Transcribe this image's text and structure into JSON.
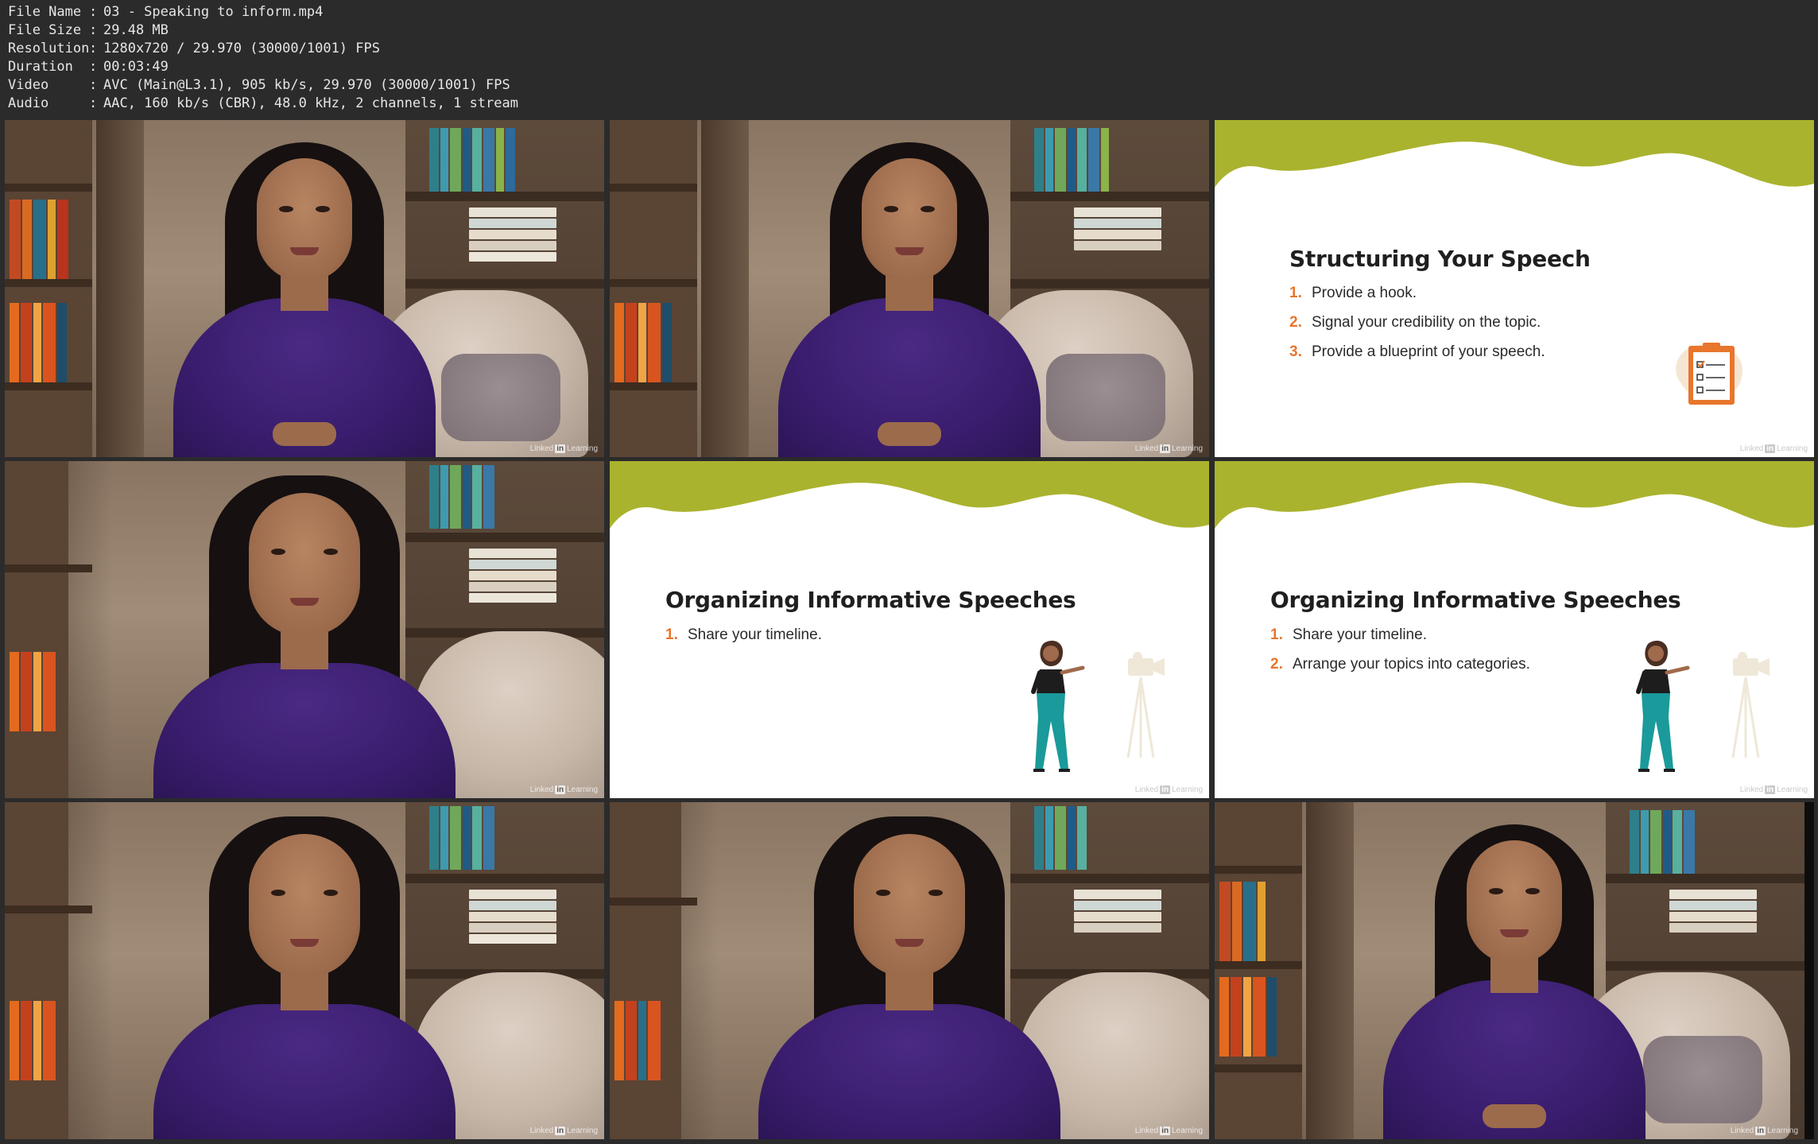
{
  "metadata": [
    {
      "key": "File Name",
      "sep": ":",
      "value": "03 - Speaking to inform.mp4"
    },
    {
      "key": "File Size",
      "sep": ":",
      "value": "29.48 MB"
    },
    {
      "key": "Resolution",
      "sep": ":",
      "value": "1280x720 / 29.970 (30000/1001) FPS"
    },
    {
      "key": "Duration",
      "sep": ":",
      "value": "00:03:49"
    },
    {
      "key": "Video",
      "sep": ":",
      "value": "AVC (Main@L3.1), 905 kb/s, 29.970 (30000/1001) FPS"
    },
    {
      "key": "Audio",
      "sep": ":",
      "value": "AAC, 160 kb/s (CBR), 48.0 kHz, 2 channels, 1 stream"
    }
  ],
  "watermark": {
    "brand": "Linked",
    "in": "in",
    "suffix": "Learning"
  },
  "colors": {
    "slide_wave": "#aab32e",
    "accent_number": "#e8762d",
    "jacket": "#3a1d6e",
    "background": "#2b2b2b"
  },
  "slides": {
    "s3": {
      "title": "Structuring Your Speech",
      "items": [
        {
          "num": "1.",
          "text": "Provide a hook."
        },
        {
          "num": "2.",
          "text": "Signal your credibility on the topic."
        },
        {
          "num": "3.",
          "text": "Provide a blueprint of your speech."
        }
      ],
      "icon": "clipboard-checklist-icon"
    },
    "s5": {
      "title": "Organizing Informative Speeches",
      "items": [
        {
          "num": "1.",
          "text": "Share your timeline."
        }
      ]
    },
    "s6": {
      "title": "Organizing Informative Speeches",
      "items": [
        {
          "num": "1.",
          "text": "Share your timeline."
        },
        {
          "num": "2.",
          "text": "Arrange your topics into categories."
        }
      ]
    }
  }
}
